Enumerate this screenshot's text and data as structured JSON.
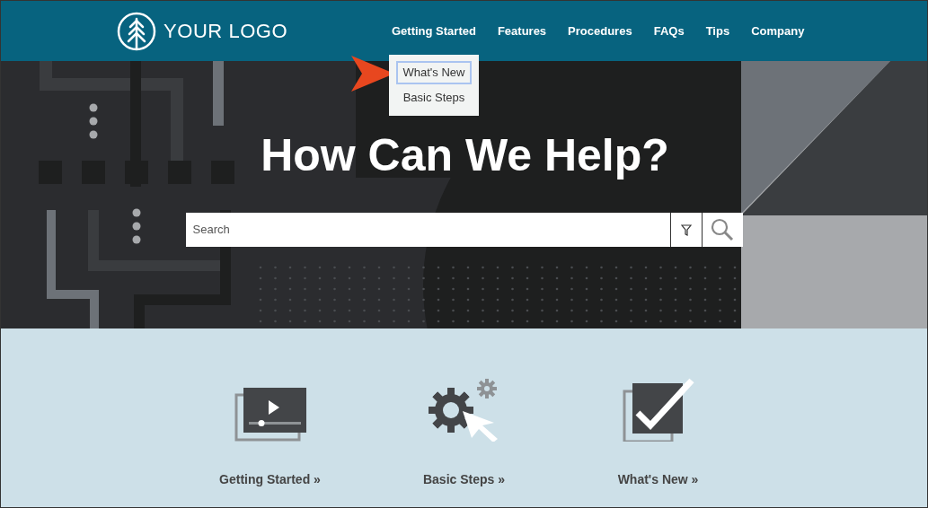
{
  "header": {
    "logo_text": "YOUR LOGO",
    "nav": [
      {
        "label": "Getting Started"
      },
      {
        "label": "Features"
      },
      {
        "label": "Procedures"
      },
      {
        "label": "FAQs"
      },
      {
        "label": "Tips"
      },
      {
        "label": "Company"
      }
    ]
  },
  "dropdown": {
    "items": [
      {
        "label": "What's New",
        "selected": true
      },
      {
        "label": "Basic Steps",
        "selected": false
      }
    ]
  },
  "hero": {
    "title": "How Can We Help?",
    "search": {
      "placeholder": "Search"
    }
  },
  "tiles": [
    {
      "kind": "video",
      "label": "Getting Started »"
    },
    {
      "kind": "gears",
      "label": "Basic Steps »"
    },
    {
      "kind": "check",
      "label": "What's New »"
    }
  ]
}
